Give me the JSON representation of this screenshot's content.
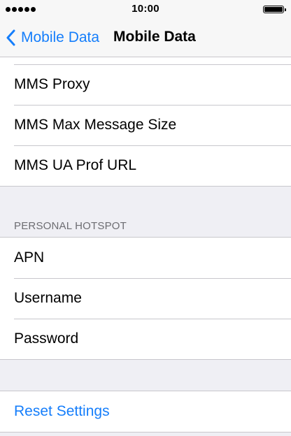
{
  "status_bar": {
    "time": "10:00",
    "signal_dots": 5,
    "battery_level": 1.0
  },
  "nav": {
    "back_label": "Mobile Data",
    "title": "Mobile Data"
  },
  "mms_group": {
    "items": [
      {
        "label": "MMS Proxy"
      },
      {
        "label": "MMS Max Message Size"
      },
      {
        "label": "MMS UA Prof URL"
      }
    ]
  },
  "hotspot": {
    "header": "PERSONAL HOTSPOT",
    "items": [
      {
        "label": "APN"
      },
      {
        "label": "Username"
      },
      {
        "label": "Password"
      }
    ]
  },
  "reset": {
    "label": "Reset Settings"
  },
  "colors": {
    "accent": "#157efb",
    "background": "#efeff4",
    "separator": "#c8c7cc"
  }
}
